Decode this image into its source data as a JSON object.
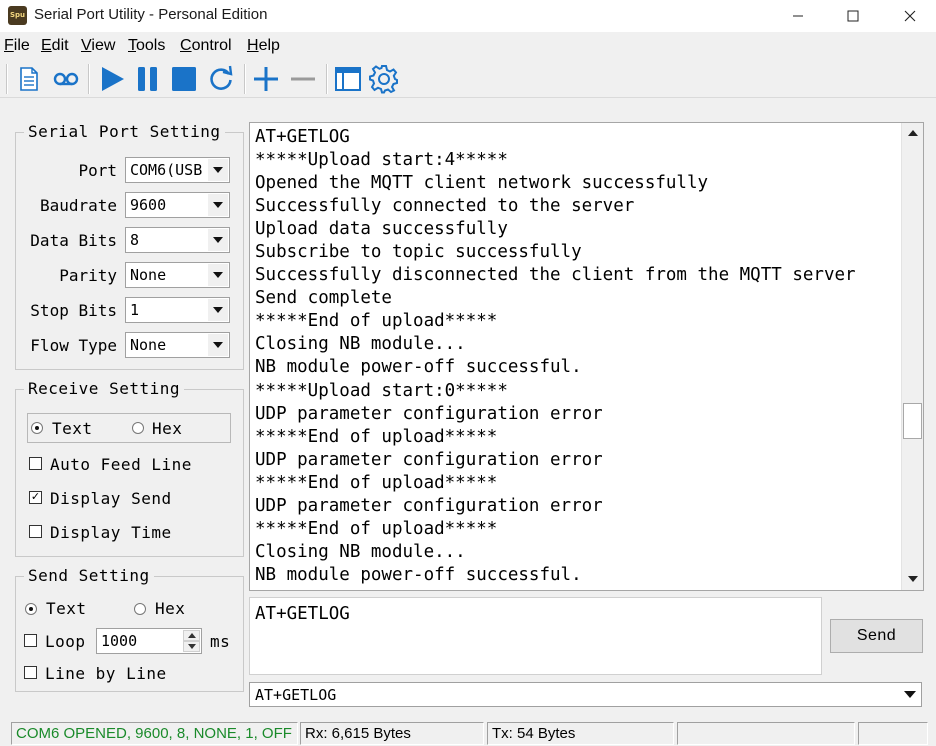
{
  "window": {
    "icon_text": "Spu",
    "title": "Serial Port Utility - Personal Edition"
  },
  "menu": [
    {
      "hot": "F",
      "rest": "ile"
    },
    {
      "hot": "E",
      "rest": "dit"
    },
    {
      "hot": "V",
      "rest": "iew"
    },
    {
      "hot": "T",
      "rest": "ools"
    },
    {
      "hot": "C",
      "rest": "ontrol"
    },
    {
      "hot": "H",
      "rest": "elp"
    }
  ],
  "colors": {
    "accent": "#1a73c8",
    "status_ok": "#1a8a2a"
  },
  "serial_setting": {
    "title": "Serial Port Setting",
    "port_label": "Port",
    "port_value": "COM6(USB",
    "baud_label": "Baudrate",
    "baud_value": "9600",
    "databits_label": "Data Bits",
    "databits_value": "8",
    "parity_label": "Parity",
    "parity_value": "None",
    "stopbits_label": "Stop Bits",
    "stopbits_value": "1",
    "flow_label": "Flow Type",
    "flow_value": "None"
  },
  "receive_setting": {
    "title": "Receive Setting",
    "text_label": "Text",
    "hex_label": "Hex",
    "mode": "Text",
    "auto_feed_label": "Auto Feed Line",
    "auto_feed": false,
    "display_send_label": "Display Send",
    "display_send": true,
    "display_time_label": "Display Time",
    "display_time": false
  },
  "send_setting": {
    "title": "Send Setting",
    "text_label": "Text",
    "hex_label": "Hex",
    "mode": "Text",
    "loop_label": "Loop",
    "loop": false,
    "loop_interval": "1000",
    "loop_unit": "ms",
    "line_by_line_label": "Line by Line",
    "line_by_line": false
  },
  "receive_lines": [
    "AT+GETLOG",
    "*****Upload start:4*****",
    "Opened the MQTT client network successfully",
    "Successfully connected to the server",
    "Upload data successfully",
    "Subscribe to topic successfully",
    "Successfully disconnected the client from the MQTT server",
    "Send complete",
    "*****End of upload*****",
    "Closing NB module...",
    "NB module power-off successful.",
    "*****Upload start:0*****",
    "UDP parameter configuration error",
    "*****End of upload*****",
    "UDP parameter configuration error",
    "*****End of upload*****",
    "UDP parameter configuration error",
    "*****End of upload*****",
    "Closing NB module...",
    "NB module power-off successful."
  ],
  "send": {
    "input_value": "AT+GETLOG",
    "button_label": "Send",
    "history_value": "AT+GETLOG"
  },
  "status": {
    "connection": "COM6 OPENED, 9600, 8, NONE, 1, OFF",
    "rx": "Rx: 6,615 Bytes",
    "tx": "Tx: 54 Bytes"
  }
}
